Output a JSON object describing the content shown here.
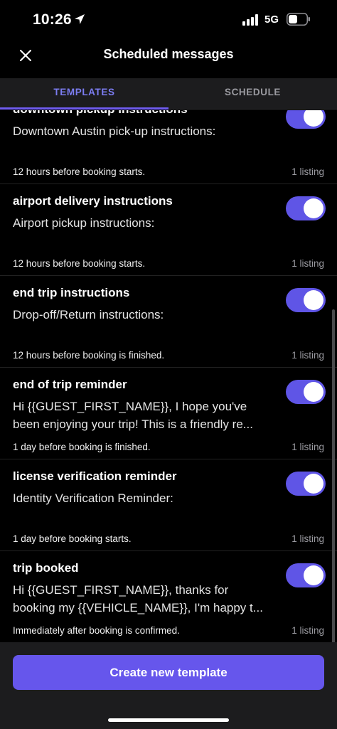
{
  "status_bar": {
    "time": "10:26",
    "network": "5G"
  },
  "header": {
    "title": "Scheduled messages"
  },
  "tabs": [
    {
      "label": "TEMPLATES",
      "active": true
    },
    {
      "label": "SCHEDULE",
      "active": false
    }
  ],
  "templates": [
    {
      "title": "downtown pickup instructions",
      "body": [
        "Downtown Austin pick-up instructions:"
      ],
      "schedule": "12 hours before booking starts.",
      "count": "1 listing",
      "enabled": true
    },
    {
      "title": "airport delivery instructions",
      "body": [
        "Airport pickup instructions:"
      ],
      "schedule": "12 hours before booking starts.",
      "count": "1 listing",
      "enabled": true
    },
    {
      "title": "end trip instructions",
      "body": [
        "Drop-off/Return instructions:"
      ],
      "schedule": "12 hours before booking is finished.",
      "count": "1 listing",
      "enabled": true
    },
    {
      "title": "end of trip reminder",
      "body": [
        "Hi {{GUEST_FIRST_NAME}}, I hope you've",
        "been enjoying your trip! This is a friendly re..."
      ],
      "schedule": "1 day before booking is finished.",
      "count": "1 listing",
      "enabled": true
    },
    {
      "title": "license verification reminder",
      "body": [
        "Identity Verification Reminder:"
      ],
      "schedule": "1 day before booking starts.",
      "count": "1 listing",
      "enabled": true
    },
    {
      "title": "trip booked",
      "body": [
        "Hi {{GUEST_FIRST_NAME}}, thanks for",
        "booking my {{VEHICLE_NAME}}, I'm happy t..."
      ],
      "schedule": "Immediately after booking is confirmed.",
      "count": "1 listing",
      "enabled": true
    }
  ],
  "footer": {
    "create_label": "Create new template"
  },
  "colors": {
    "accent": "#6656ec",
    "toggle_on": "#5f55e6",
    "tab_active": "#7b7cf0",
    "background": "#000000"
  }
}
